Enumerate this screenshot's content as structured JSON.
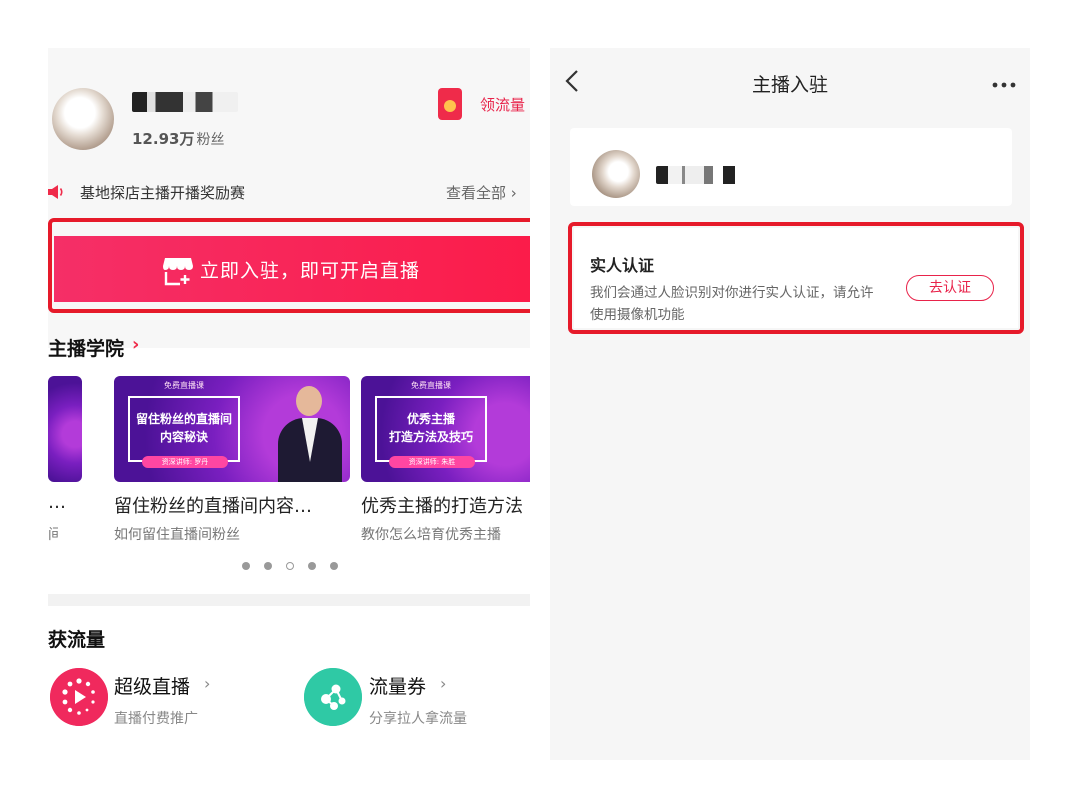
{
  "left": {
    "profile": {
      "fans_count": "12.93万",
      "fans_label": "粉丝"
    },
    "flow_link": "领流量",
    "announcement": {
      "text": "基地探店主播开播奖励赛",
      "see_all": "查看全部 ›"
    },
    "join_button": "立即入驻，即可开启直播",
    "academy": {
      "title": "主播学院",
      "chevron": "›",
      "cards": [
        {
          "thumb_top": "免费直播课",
          "thumb_text": "留住粉丝的直播间\n内容秘诀",
          "thumb_badge": "资深讲师: 罗丹",
          "title": "留住粉丝的直播间内容…",
          "subtitle": "如何留住直播间粉丝"
        },
        {
          "thumb_top": "免费直播课",
          "thumb_text": "优秀主播\n打造方法及技巧",
          "thumb_badge": "资深讲师: 朱胜",
          "title": "优秀主播的打造方法",
          "subtitle": "教你怎么培育优秀主播"
        }
      ],
      "partial_card": {
        "title": "…",
        "subtitle": "间"
      }
    },
    "carousel_dots": {
      "count": 5,
      "active_index": 2
    },
    "flow": {
      "title": "获流量",
      "items": [
        {
          "name": "超级直播",
          "subtitle": "直播付费推广",
          "icon": "live-boost-icon",
          "color": "#f0295d"
        },
        {
          "name": "流量券",
          "subtitle": "分享拉人拿流量",
          "icon": "coupon-icon",
          "color": "#2fc9a5"
        }
      ],
      "chevron": "›"
    }
  },
  "right": {
    "header": {
      "title": "主播入驻",
      "back_icon": "back-chevron-icon",
      "more_icon": "more-icon"
    },
    "verify": {
      "title": "实人认证",
      "description": "我们会通过人脸识别对你进行实人认证，请允许使用摄像机功能",
      "button": "去认证"
    }
  },
  "colors": {
    "accent": "#e8234a",
    "highlight_outline": "#e61a2a",
    "panel_bg": "#f6f6f6"
  }
}
